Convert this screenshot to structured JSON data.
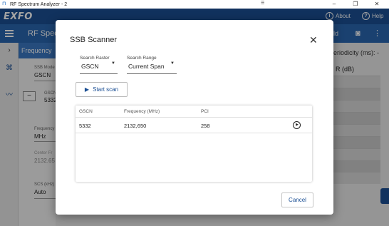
{
  "window": {
    "title": "RF Spectrum Analyzer - 2",
    "menu_glyph": "☰",
    "minimize": "–",
    "maximize": "❐",
    "close": "✕"
  },
  "header": {
    "logo": "EXFO",
    "about_label": "About",
    "help_label": "Help",
    "about_icon": "i",
    "help_icon": "?"
  },
  "toolbar": {
    "title": "RF Spect",
    "partial_right_label": "ld"
  },
  "left_panel": {
    "tab": "Frequency",
    "ssb_mode_label": "SSB Mode",
    "ssb_mode_value": "GSCN",
    "gscn_label": "GSCN",
    "gscn_value": "5332",
    "frequency_label": "Frequency",
    "frequency_value": "MHz",
    "center_freq_label": "Center Fr",
    "center_freq_value": "2132.65",
    "scs_label": "SCS (kHz)",
    "scs_value": "Auto",
    "minus_label": "−"
  },
  "right_area": {
    "periodicity_label": "eriodicity (ms): -",
    "column_header": "R (dB)"
  },
  "dialog": {
    "title": "SSB Scanner",
    "close_glyph": "✕",
    "search_raster": {
      "label": "Search Raster",
      "value": "GSCN"
    },
    "search_range": {
      "label": "Search Range",
      "value": "Current Span"
    },
    "start_scan_label": "Start scan",
    "table": {
      "headers": [
        "GSCN",
        "Frequency (MHz)",
        "PCI"
      ],
      "rows": [
        {
          "gscn": "5332",
          "frequency": "2132,650",
          "pci": "258"
        }
      ]
    },
    "cancel_label": "Cancel"
  },
  "colors": {
    "brand": "#1b4f94",
    "toolbar": "#2a67b0",
    "accent_text": "#1b4f94"
  }
}
